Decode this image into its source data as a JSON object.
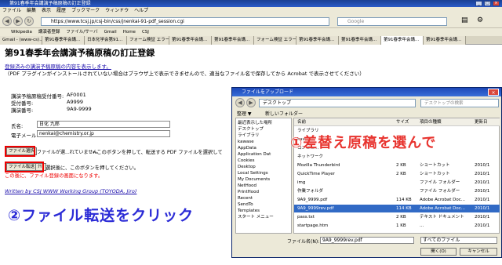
{
  "window": {
    "title": "第91春季年会講演予稿原稿の訂正登録",
    "min": "_",
    "max": "□",
    "close": "×"
  },
  "menu": [
    "ファイル",
    "編集",
    "表示",
    "履歴",
    "ブックマーク",
    "ウィンドウ",
    "ヘルプ"
  ],
  "nav": {
    "back": "◀",
    "forward": "▶",
    "reload": "↻",
    "stop": "✕",
    "home": "⌂",
    "url": "https://www.tcsj.jp/csj-bin/css/jnenkai-91-pdf_session.cgi",
    "search_placeholder": "Google"
  },
  "bookmarks": [
    "Wikipedia",
    "講演者登録",
    "ファイル/サーバ",
    "Gmail",
    "Home",
    "CSJ"
  ],
  "tabs": [
    "Gmail - (www-cs)...",
    "第91春季年会講...",
    "日本化学会第91...",
    "フォーム検証 エラー...",
    "第91春季年会講...",
    "第91春季年会講...",
    "フォーム検証 エラー...",
    "第91春季年会講...",
    "第91春季年会講...",
    "第91春季年会講...",
    "第91春季年会講..."
  ],
  "page": {
    "title": "第91春季年会講演予稿原稿の訂正登録",
    "link": "登録済みの講演予稿原稿の内容を表示します。",
    "note": "（PDF プラグインがインストールされていない場合はブラウザ上で表示できませんので、適当なファイル名で保存してから Acrobat で表示させてください）",
    "receipt_label": "講演予稿原稿受付番号:",
    "receipt_value": "AF0001",
    "accept_label": "受付番号:",
    "accept_value": "A9999",
    "lecture_label": "講演番号:",
    "lecture_value": "9A9-9999",
    "name_label": "氏名:",
    "name_value": "日化 九郎",
    "email_label": "電子メール:",
    "email_value": "nenkai@chemistry.or.jp",
    "file_select_label": "ファイル選択",
    "file_status": "ファイルが選...れていません",
    "file_note": "←このボタンを押して、転送する PDF ファイルを選択して",
    "transfer_label": "ファイル転送",
    "reset_label": "ｸﾘｱ",
    "transfer_note": "選択後に、このボタンを押してください。",
    "done_note": "この後に、ファイル登録の画面になります。",
    "footer": "Written by CSJ WWW Working Group (TOYODA, Jiro)"
  },
  "annotations": {
    "step1": "①差替え原稿を選んで",
    "step2": "②ファイル転送をクリック"
  },
  "dialog": {
    "title": "ファイルをアップロード",
    "path": "デスクトップ",
    "search_placeholder": "デスクトップの検索",
    "organize": "整理 ▼",
    "new_folder": "新しいフォルダー",
    "sidebar": [
      "最近表示した場所",
      "デスクトップ",
      "ライブラリ",
      "kawase",
      "AppData",
      "Application Dat",
      "Cookies",
      "Desktop",
      "Local Settings",
      "My Documents",
      "NetHood",
      "PrintHood",
      "Recent",
      "SendTo",
      "Templates",
      "スタート メニュー"
    ],
    "columns": [
      "名前",
      "サイズ",
      "項目の種類",
      "更新日"
    ],
    "files": [
      {
        "name": "ライブラリ",
        "size": "",
        "type": "",
        "date": ""
      },
      {
        "name": "kawase",
        "size": "",
        "type": "",
        "date": ""
      },
      {
        "name": "コンピュ...",
        "size": "",
        "type": "",
        "date": ""
      },
      {
        "name": "ネットワーク",
        "size": "",
        "type": "",
        "date": ""
      },
      {
        "name": "Mozilla Thunderbird",
        "size": "2 KB",
        "type": "ショートカット",
        "date": "2010/1"
      },
      {
        "name": "QuickTime Player",
        "size": "2 KB",
        "type": "ショートカット",
        "date": "2010/1"
      },
      {
        "name": "img",
        "size": "",
        "type": "ファイル フォルダー",
        "date": "2010/1"
      },
      {
        "name": "作業フォルダ",
        "size": "",
        "type": "ファイル フォルダー",
        "date": "2010/1"
      },
      {
        "name": "9A9_9999.pdf",
        "size": "114 KB",
        "type": "Adobe Acrobat Doc...",
        "date": "2010/1"
      },
      {
        "name": "9A9_9999rev.pdf",
        "size": "114 KB",
        "type": "Adobe Acrobat Doc...",
        "date": "2010/1"
      },
      {
        "name": "pass.txt",
        "size": "2 KB",
        "type": "テキスト ドキュメント",
        "date": "2010/1"
      },
      {
        "name": "startpage.htm",
        "size": "1 KB",
        "type": "...",
        "date": "2010/1"
      }
    ],
    "selected_index": 9,
    "filename_label": "ファイル名(N):",
    "filename_value": "9A9_9999rev.pdf",
    "filter_value": "すべてのファイル",
    "open_label": "開く(O)",
    "cancel_label": "キャンセル"
  }
}
